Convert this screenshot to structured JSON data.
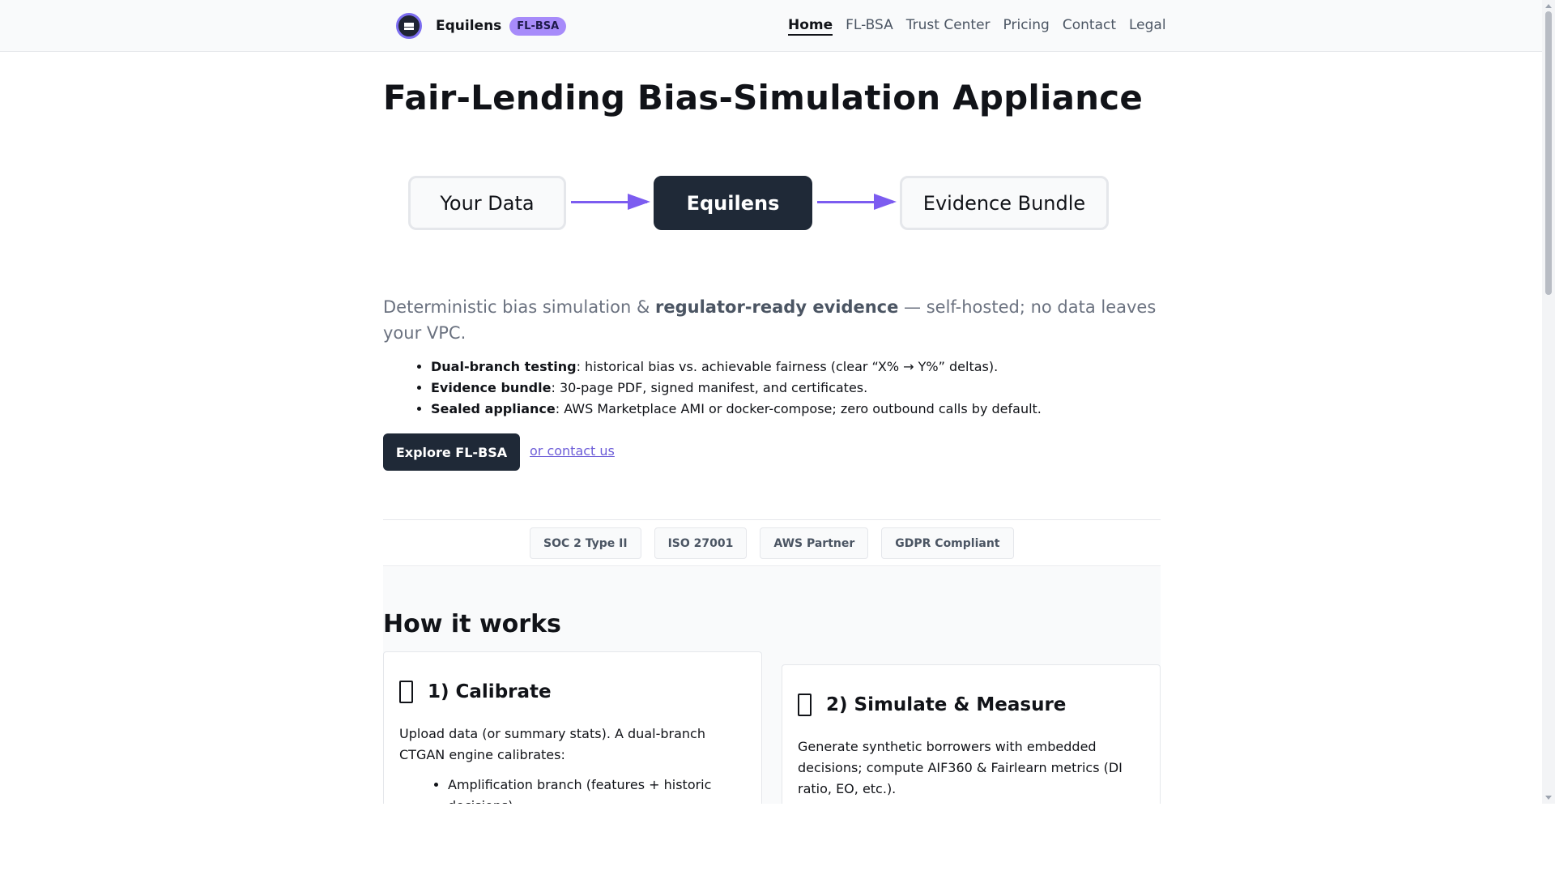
{
  "nav": {
    "brand_name": "Equilens",
    "brand_badge": "FL-BSA",
    "links": [
      "Home",
      "FL-BSA",
      "Trust Center",
      "Pricing",
      "Contact",
      "Legal"
    ],
    "active": "Home"
  },
  "hero": {
    "title": "Fair-Lending Bias-Simulation Appliance",
    "flow": [
      "Your Data",
      "Equilens",
      "Evidence Bundle"
    ],
    "lead_prefix": "Deterministic bias simulation & ",
    "lead_bold": "regulator-ready evidence",
    "lead_suffix": " — self-hosted; no data leaves your VPC.",
    "features": [
      {
        "bold": "Dual-branch testing",
        "text": ": historical bias vs. achievable fairness (clear “X% → Y%” deltas)."
      },
      {
        "bold": "Evidence bundle",
        "text": ": 30-page PDF, signed manifest, and certificates."
      },
      {
        "bold": "Sealed appliance",
        "text": ": AWS Marketplace AMI or docker-compose; zero outbound calls by default."
      }
    ],
    "cta_label": "Explore FL-BSA",
    "contact_label": "or contact us"
  },
  "trust_badges": [
    "SOC 2 Type II",
    "ISO 27001",
    "AWS Partner",
    "GDPR Compliant"
  ],
  "how": {
    "title": "How it works",
    "steps": [
      {
        "title": "1) Calibrate",
        "body": "Upload data (or summary stats). A dual-branch CTGAN engine calibrates:",
        "bullets": [
          "Amplification branch (features + historic decisions)"
        ]
      },
      {
        "title": "2) Simulate & Measure",
        "body": "Generate synthetic borrowers with embedded decisions; compute AIF360 & Fairlearn metrics (DI ratio, EO, etc.)."
      }
    ]
  },
  "colors": {
    "accent": "#7c5cf0",
    "dark": "#1f2937",
    "badge": "#a78bfa",
    "muted": "#6b7280"
  }
}
